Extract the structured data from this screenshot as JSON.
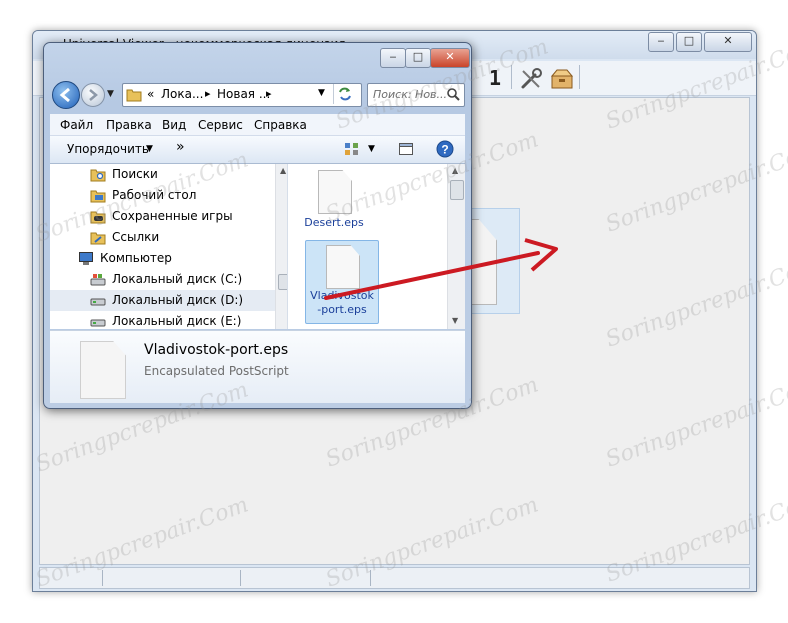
{
  "viewer": {
    "title": "Universal Viewer - некоммерческая лицензия",
    "toolbar_page": "1",
    "window_buttons": [
      "‒",
      "□",
      "✕"
    ]
  },
  "explorer": {
    "address": {
      "segments": [
        "«",
        "Лока...",
        "▸",
        "Новая ...",
        "▸"
      ]
    },
    "search": {
      "placeholder": "Поиск: Нов..."
    },
    "menu": [
      "Файл",
      "Правка",
      "Вид",
      "Сервис",
      "Справка"
    ],
    "cmdbar": {
      "organize": "Упорядочить",
      "more": "»"
    },
    "nav_items": [
      {
        "label": "Поиски",
        "icon": "search-folder-icon"
      },
      {
        "label": "Рабочий стол",
        "icon": "desktop-folder-icon"
      },
      {
        "label": "Сохраненные игры",
        "icon": "saved-games-icon"
      },
      {
        "label": "Ссылки",
        "icon": "links-folder-icon"
      },
      {
        "label": "Компьютер",
        "icon": "computer-icon"
      },
      {
        "label": "Локальный диск (C:)",
        "icon": "drive-c-icon"
      },
      {
        "label": "Локальный диск (D:)",
        "icon": "drive-icon"
      },
      {
        "label": "Локальный диск (E:)",
        "icon": "drive-icon"
      }
    ],
    "files": [
      {
        "name": "Desert.eps"
      },
      {
        "name_line1": "Vladivostok",
        "name_line2": "-port.eps"
      }
    ],
    "details": {
      "filename": "Vladivostok-port.eps",
      "filetype": "Encapsulated PostScript"
    }
  },
  "watermark": "Soringpcrepair.Com",
  "colors": {
    "arrow": "#cc1a22",
    "selection": "#cce4f7",
    "accent": "#1f5fb8"
  }
}
